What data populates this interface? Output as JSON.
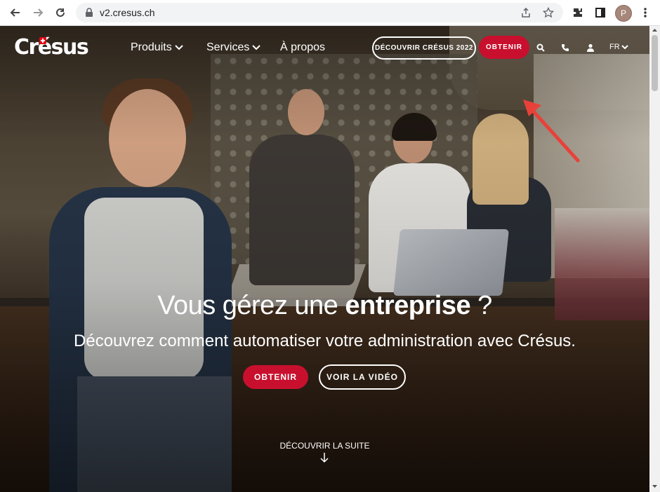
{
  "browser": {
    "url": "v2.cresus.ch",
    "profile_initial": "P"
  },
  "site": {
    "logo": "Crésus",
    "nav": {
      "produits": "Produits",
      "services": "Services",
      "apropos": "À propos"
    },
    "header_buttons": {
      "discover": "DÉCOUVRIR CRÉSUS 2022",
      "obtain": "OBTENIR"
    },
    "language": "FR"
  },
  "hero": {
    "headline_prefix": "Vous gérez une ",
    "headline_bold": "entreprise",
    "headline_suffix": " ?",
    "subheadline": "Découvrez comment automatiser votre administration avec Crésus.",
    "cta_primary": "OBTENIR",
    "cta_secondary": "VOIR LA VIDÉO",
    "scroll_cta": "DÉCOUVRIR LA SUITE"
  },
  "colors": {
    "accent_red": "#c8102e",
    "annotation_red": "#e8413a",
    "text_white": "#ffffff"
  }
}
